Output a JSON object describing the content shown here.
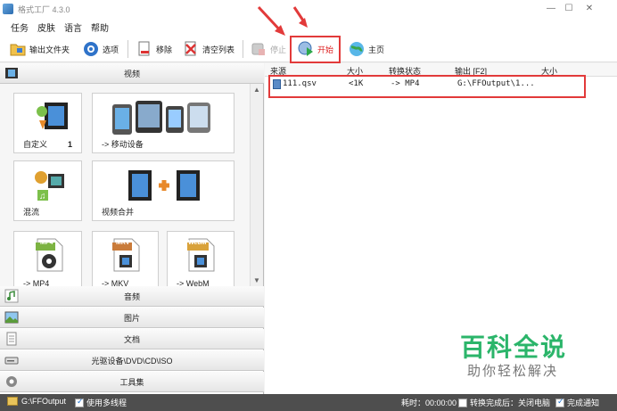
{
  "window": {
    "title": "格式工厂 4.3.0",
    "minimize": "—",
    "maximize": "☐",
    "close": "✕"
  },
  "menu": [
    "任务",
    "皮肤",
    "语言",
    "帮助"
  ],
  "toolbar": {
    "output_folder": "输出文件夹",
    "options": "选项",
    "remove": "移除",
    "clear_list": "清空列表",
    "stop": "停止",
    "start": "开始",
    "home": "主页"
  },
  "sections": {
    "video": "视频",
    "audio": "音频",
    "picture": "图片",
    "document": "文档",
    "disc": "光驱设备\\DVD\\CD\\ISO",
    "tools": "工具集"
  },
  "video_tiles": [
    {
      "label": "自定义",
      "count": "1"
    },
    {
      "label": "-> 移动设备"
    },
    {
      "label": "混流"
    },
    {
      "label": "视频合并"
    },
    {
      "label": "-> MP4",
      "badge": "MP4"
    },
    {
      "label": "-> MKV",
      "badge": "MKV"
    },
    {
      "label": "-> WebM",
      "badge": "WebM"
    }
  ],
  "table": {
    "headers": [
      "来源",
      "大小",
      "转换状态",
      "输出 [F2]",
      "大小"
    ],
    "rows": [
      {
        "source": "111.qsv",
        "size": "<1K",
        "status": "-> MP4",
        "output": "G:\\FFOutput\\1...",
        "out_size": ""
      }
    ]
  },
  "status": {
    "path": "G:\\FFOutput",
    "multithread": "使用多线程",
    "elapsed": "耗时：00:00:00",
    "shutdown": "转换完成后：关闭电脑",
    "notify": "完成通知"
  },
  "watermark": {
    "title": "百科全说",
    "subtitle": "助你轻松解决"
  }
}
